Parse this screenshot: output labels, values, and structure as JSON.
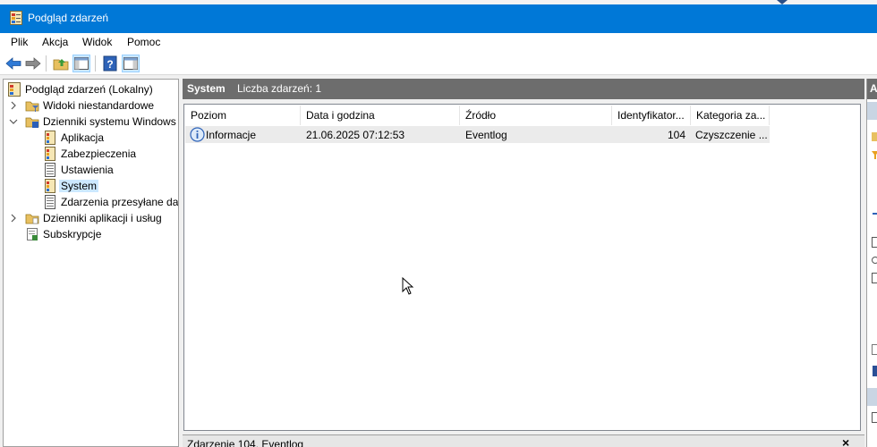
{
  "window": {
    "title": "Podgląd zdarzeń"
  },
  "menu": {
    "items": [
      "Plik",
      "Akcja",
      "Widok",
      "Pomoc"
    ]
  },
  "toolbar": {
    "buttons": [
      "back-arrow",
      "forward-arrow",
      "up-folder",
      "show-hide-console-tree",
      "help",
      "show-hide-action-pane"
    ]
  },
  "tree": {
    "root": "Podgląd zdarzeń (Lokalny)",
    "custom_views": "Widoki niestandardowe",
    "windows_logs": "Dzienniki systemu Windows",
    "application": "Aplikacja",
    "security": "Zabezpieczenia",
    "setup": "Ustawienia",
    "system": "System",
    "forwarded": "Zdarzenia przesyłane dalej",
    "app_service_logs": "Dzienniki aplikacji i usług",
    "subscriptions": "Subskrypcje"
  },
  "center": {
    "log_name": "System",
    "event_count": "Liczba zdarzeń: 1",
    "columns": [
      "Poziom",
      "Data i godzina",
      "Źródło",
      "Identyfikator...",
      "Kategoria za..."
    ],
    "rows": [
      {
        "level": "Informacje",
        "datetime": "21.06.2025 07:12:53",
        "source": "Eventlog",
        "event_id": "104",
        "category": "Czyszczenie ..."
      }
    ]
  },
  "detail": {
    "title": "Zdarzenie 104, Eventlog",
    "close": "×"
  },
  "actions": {
    "header": "A"
  },
  "colors": {
    "titlebar": "#0078d7",
    "pane_header": "#6d6d6d",
    "selection": "#cce8ff"
  }
}
